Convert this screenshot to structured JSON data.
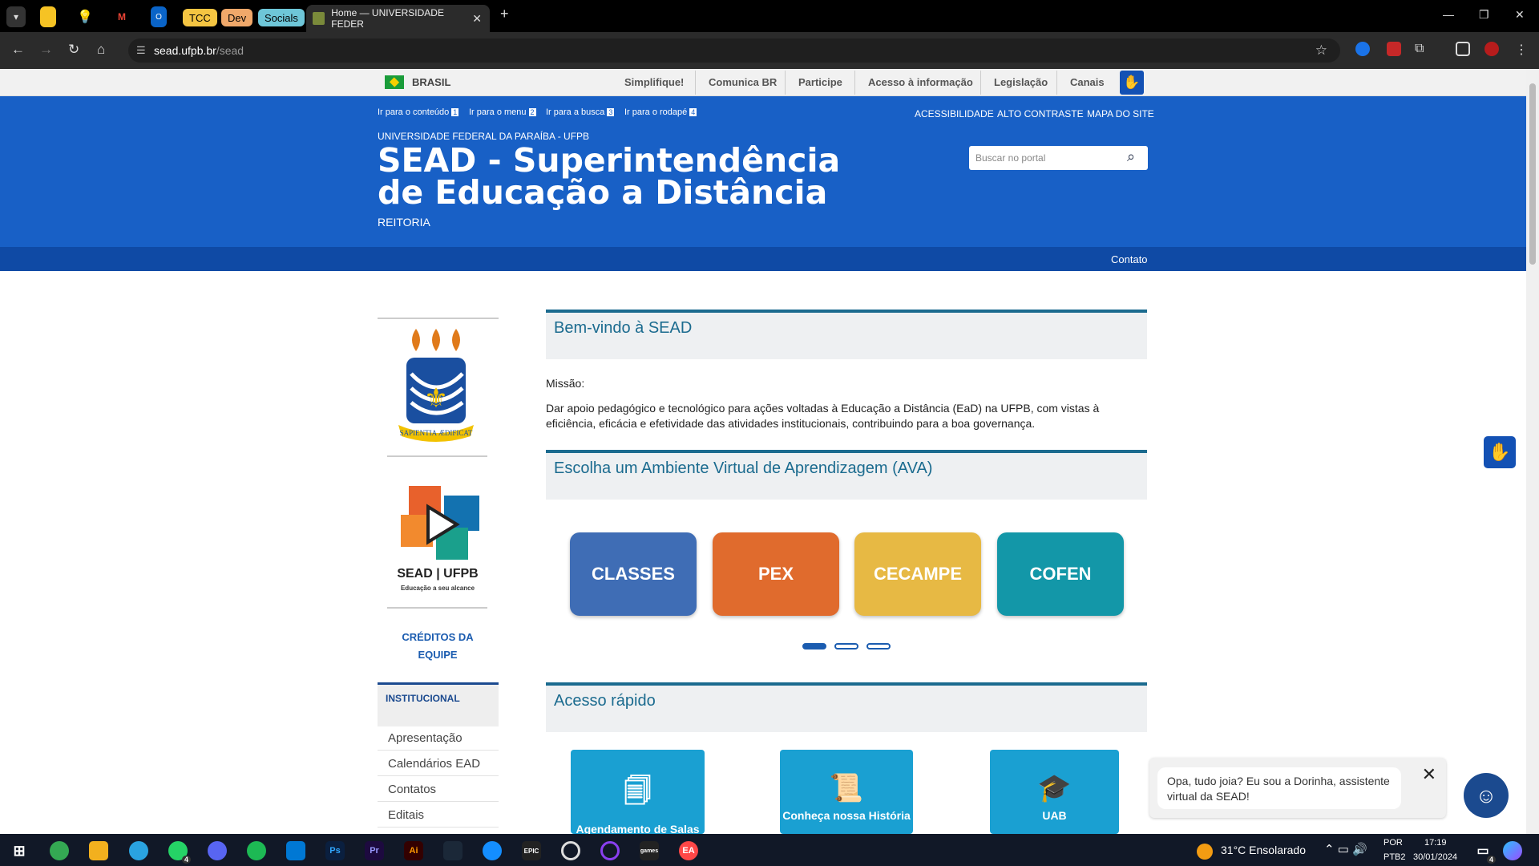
{
  "browser": {
    "tab_groups": [
      {
        "label": "TCC",
        "color": "#f4c542"
      },
      {
        "label": "Dev",
        "color": "#f0a86a"
      },
      {
        "label": "Socials",
        "color": "#6ec6d8"
      }
    ],
    "active_tab": {
      "title": "Home — UNIVERSIDADE FEDER"
    },
    "url": {
      "host": "sead.ufpb.br",
      "path": "/sead"
    }
  },
  "gov_bar": {
    "country": "BRASIL",
    "links": [
      "Simplifique!",
      "Comunica BR",
      "Participe",
      "Acesso à informação",
      "Legislação",
      "Canais"
    ]
  },
  "header": {
    "skip_links": [
      {
        "label": "Ir para o conteúdo",
        "key": "1"
      },
      {
        "label": "Ir para o menu",
        "key": "2"
      },
      {
        "label": "Ir para a busca",
        "key": "3"
      },
      {
        "label": "Ir para o rodapé",
        "key": "4"
      }
    ],
    "accessibility_links": [
      "ACESSIBILIDADE",
      "ALTO CONTRASTE",
      "MAPA DO SITE"
    ],
    "org": "UNIVERSIDADE FEDERAL DA PARAÍBA - UFPB",
    "title": "SEAD - Superintendência de Educação a Distância",
    "subtitle": "REITORIA",
    "search_placeholder": "Buscar no portal",
    "contact": "Contato"
  },
  "sidebar": {
    "crest_motto": "SAPIENTIA ÆDIFICAT",
    "sead_logo_title": "SEAD | UFPB",
    "sead_logo_tagline": "Educação a seu alcance",
    "credits": "CRÉDITOS DA EQUIPE",
    "section_title": "INSTITUCIONAL",
    "items": [
      "Apresentação",
      "Calendários EAD",
      "Contatos",
      "Editais"
    ]
  },
  "main": {
    "welcome_title": "Bem-vindo à SEAD",
    "mission_label": "Missão:",
    "mission_text": "Dar apoio pedagógico e tecnológico para ações voltadas à Educação a Distância (EaD) na UFPB, com vistas à eficiência, eficácia e efetividade das atividades institucionais, contribuindo para a boa governança.",
    "ava_title": "Escolha um Ambiente Virtual de Aprendizagem (AVA)",
    "ava_cards": [
      {
        "label": "CLASSES",
        "color": "#3f6db5"
      },
      {
        "label": "PEX",
        "color": "#e06b2d"
      },
      {
        "label": "CECAMPE",
        "color": "#e7b944"
      },
      {
        "label": "COFEN",
        "color": "#1397a8"
      }
    ],
    "carousel_active": 1,
    "quick_title": "Acesso rápido",
    "quick_items": [
      "Agendamento de Salas",
      "Conheça nossa História",
      "UAB"
    ]
  },
  "chat": {
    "message": "Opa, tudo joia? Eu sou a Dorinha, assistente virtual da SEAD!"
  },
  "taskbar": {
    "weather": "31°C  Ensolarado",
    "lang": "POR",
    "layout": "PTB2",
    "time": "17:19",
    "date": "30/01/2024",
    "whatsapp_badge": "4",
    "notif_badge": "4"
  }
}
